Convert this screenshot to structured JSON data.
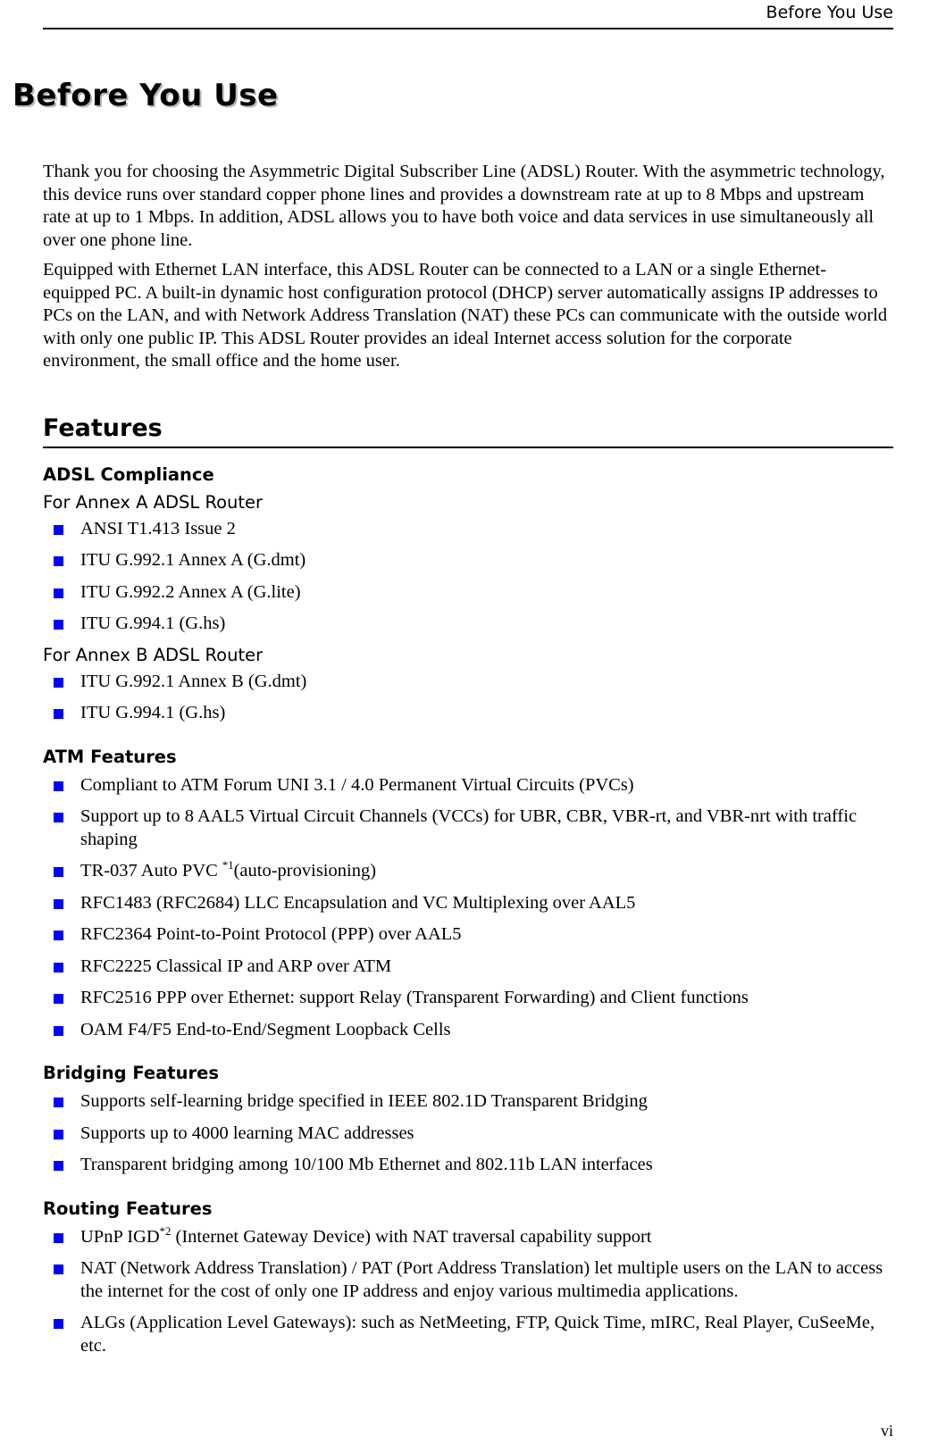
{
  "header": {
    "running_title": "Before You Use"
  },
  "chapter": {
    "title": "Before You Use"
  },
  "intro": {
    "paragraph_1": "Thank you for choosing the Asymmetric Digital Subscriber Line (ADSL) Router. With the asymmetric technology, this device runs over standard copper phone lines and provides a downstream rate at up to 8 Mbps and upstream rate at up to 1 Mbps. In addition, ADSL allows you to have both voice and data services in use simultaneously all over one phone line.",
    "paragraph_2": "Equipped with Ethernet LAN interface, this ADSL Router can be connected to a LAN or a single Ethernet-equipped PC. A built-in dynamic host configuration protocol (DHCP) server automatically assigns IP addresses to PCs on the LAN, and with Network Address Translation (NAT) these PCs can communicate with the outside world with only one public IP. This ADSL Router provides an ideal Internet access solution for the corporate environment, the small office and the home user."
  },
  "features": {
    "heading": "Features",
    "adsl_compliance": {
      "heading": "ADSL Compliance",
      "annex_a_label": "For Annex A ADSL Router",
      "annex_a_items": [
        "ANSI T1.413 Issue 2",
        "ITU G.992.1 Annex A (G.dmt)",
        "ITU G.992.2 Annex A (G.lite)",
        "ITU G.994.1 (G.hs)"
      ],
      "annex_b_label": "For Annex B ADSL Router",
      "annex_b_items": [
        "ITU G.992.1 Annex B (G.dmt)",
        "ITU G.994.1 (G.hs)"
      ]
    },
    "atm": {
      "heading": "ATM Features",
      "items": [
        "Compliant to ATM Forum UNI 3.1 / 4.0 Permanent Virtual Circuits (PVCs)",
        "Support up to 8 AAL5 Virtual Circuit Channels (VCCs) for UBR, CBR, VBR-rt, and VBR-nrt with traffic shaping",
        "RFC1483 (RFC2684) LLC Encapsulation and VC Multiplexing over AAL5",
        "RFC2364 Point-to-Point Protocol (PPP) over AAL5",
        "RFC2225 Classical IP and ARP over ATM",
        "RFC2516 PPP over Ethernet: support Relay (Transparent Forwarding) and Client functions",
        "OAM F4/F5 End-to-End/Segment Loopback Cells"
      ],
      "auto_pvc": {
        "text_before": "TR-037 Auto PVC ",
        "note_ref": "*1",
        "text_after": "(auto-provisioning)"
      }
    },
    "bridging": {
      "heading": "Bridging Features",
      "items": [
        "Supports self-learning bridge specified in IEEE 802.1D Transparent Bridging",
        "Supports up to 4000 learning MAC addresses",
        "Transparent bridging among 10/100 Mb Ethernet and 802.11b LAN interfaces"
      ]
    },
    "routing": {
      "heading": "Routing Features",
      "upnp": {
        "text_before": "UPnP IGD",
        "note_ref": "*2",
        "text_after": " (Internet Gateway Device) with NAT traversal capability support"
      },
      "items": [
        "NAT (Network Address Translation) / PAT (Port Address Translation) let multiple users on the LAN to access the internet for the cost of only one IP address and enjoy various multimedia applications.",
        "ALGs (Application Level Gateways): such as NetMeeting, FTP, Quick Time, mIRC, Real Player, CuSeeMe, etc."
      ]
    }
  },
  "footer": {
    "page_number": "vi"
  },
  "colors": {
    "bullet": "#0000ff",
    "text": "#000000",
    "rule": "#000000"
  }
}
